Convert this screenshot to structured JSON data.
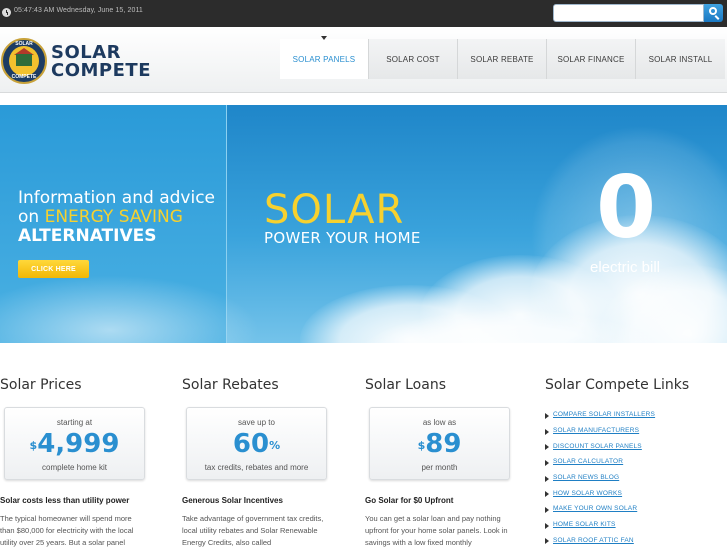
{
  "topbar": {
    "datetime": "05:47:43 AM Wednesday, June 15, 2011",
    "search_placeholder": "",
    "icons": {
      "clock": "clock-icon",
      "search": "search-icon"
    }
  },
  "logo": {
    "badge_top": "SOLAR",
    "badge_bottom": "COMPETE",
    "line1": "SOLAR",
    "line2": "COMPETE"
  },
  "nav": {
    "items": [
      {
        "label": "SOLAR PANELS",
        "active": true
      },
      {
        "label": "SOLAR COST",
        "active": false
      },
      {
        "label": "SOLAR REBATE",
        "active": false
      },
      {
        "label": "SOLAR FINANCE",
        "active": false
      },
      {
        "label": "SOLAR INSTALL",
        "active": false
      }
    ]
  },
  "hero": {
    "info_line1": "Information and advice",
    "info_on": "on ",
    "info_accent": "ENERGY SAVING",
    "info_line3": "ALTERNATIVES",
    "cta": "CLICK HERE",
    "solar": "SOLAR",
    "subtitle": "POWER YOUR HOME",
    "zero": "0",
    "electric": "electric bill"
  },
  "columns": [
    {
      "title": "Solar Prices",
      "box_top": "starting at",
      "currency": "$",
      "value": "4,999",
      "suffix": "",
      "box_bottom": "complete home kit",
      "heading": "Solar costs less than utility power",
      "body": "The typical homeowner will spend more than $80,000 for electricity with the local utility over 25 years. But a solar panel"
    },
    {
      "title": "Solar Rebates",
      "box_top": "save up to",
      "currency": "",
      "value": "60",
      "suffix": "%",
      "box_bottom": "tax credits, rebates and more",
      "heading": "Generous Solar Incentives",
      "body": "Take advantage of government tax credits, local utility rebates and Solar Renewable Energy Credits, also called"
    },
    {
      "title": "Solar Loans",
      "box_top": "as low as",
      "currency": "$",
      "value": "89",
      "suffix": "",
      "box_bottom": "per month",
      "heading": "Go Solar for $0 Upfront",
      "body": "You can get a solar loan and pay nothing upfront for your home solar panels. Look in savings with a low fixed monthly"
    }
  ],
  "links": {
    "title": "Solar Compete Links",
    "items": [
      "COMPARE SOLAR INSTALLERS",
      "SOLAR MANUFACTURERS",
      "DISCOUNT SOLAR PANELS",
      "SOLAR CALCULATOR",
      "SOLAR NEWS BLOG",
      "HOW SOLAR WORKS",
      "MAKE YOUR OWN SOLAR",
      "HOME SOLAR KITS",
      "SOLAR ROOF ATTIC FAN"
    ]
  }
}
